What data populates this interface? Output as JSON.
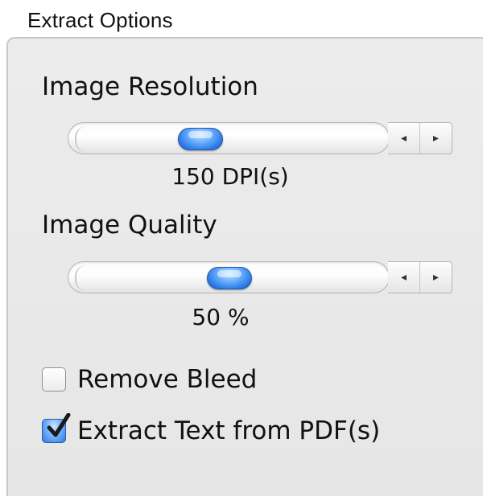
{
  "panel": {
    "title": "Extract Options"
  },
  "image_resolution": {
    "label": "Image Resolution",
    "value_text": "150 DPI(s)",
    "slider_fraction": 0.38,
    "stepper_left": "◂",
    "stepper_right": "▸"
  },
  "image_quality": {
    "label": "Image Quality",
    "value_text": "50 %",
    "slider_fraction": 0.5,
    "stepper_left": "◂",
    "stepper_right": "▸"
  },
  "options": {
    "remove_bleed": {
      "label": "Remove Bleed",
      "checked": false
    },
    "extract_text": {
      "label": "Extract Text from PDF(s)",
      "checked": true
    }
  },
  "colors": {
    "accent": "#2a78e6",
    "panel_bg": "#e8e8e8",
    "panel_border": "#c8c8c8"
  }
}
